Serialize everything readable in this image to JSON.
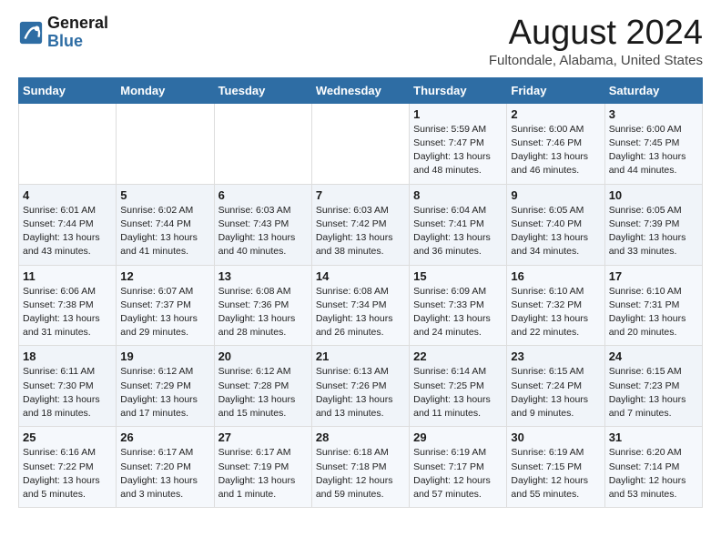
{
  "app": {
    "logo_line1": "General",
    "logo_line2": "Blue"
  },
  "header": {
    "title": "August 2024",
    "subtitle": "Fultondale, Alabama, United States"
  },
  "calendar": {
    "days_of_week": [
      "Sunday",
      "Monday",
      "Tuesday",
      "Wednesday",
      "Thursday",
      "Friday",
      "Saturday"
    ],
    "weeks": [
      [
        {
          "day": "",
          "info": ""
        },
        {
          "day": "",
          "info": ""
        },
        {
          "day": "",
          "info": ""
        },
        {
          "day": "",
          "info": ""
        },
        {
          "day": "1",
          "info": "Sunrise: 5:59 AM\nSunset: 7:47 PM\nDaylight: 13 hours\nand 48 minutes."
        },
        {
          "day": "2",
          "info": "Sunrise: 6:00 AM\nSunset: 7:46 PM\nDaylight: 13 hours\nand 46 minutes."
        },
        {
          "day": "3",
          "info": "Sunrise: 6:00 AM\nSunset: 7:45 PM\nDaylight: 13 hours\nand 44 minutes."
        }
      ],
      [
        {
          "day": "4",
          "info": "Sunrise: 6:01 AM\nSunset: 7:44 PM\nDaylight: 13 hours\nand 43 minutes."
        },
        {
          "day": "5",
          "info": "Sunrise: 6:02 AM\nSunset: 7:44 PM\nDaylight: 13 hours\nand 41 minutes."
        },
        {
          "day": "6",
          "info": "Sunrise: 6:03 AM\nSunset: 7:43 PM\nDaylight: 13 hours\nand 40 minutes."
        },
        {
          "day": "7",
          "info": "Sunrise: 6:03 AM\nSunset: 7:42 PM\nDaylight: 13 hours\nand 38 minutes."
        },
        {
          "day": "8",
          "info": "Sunrise: 6:04 AM\nSunset: 7:41 PM\nDaylight: 13 hours\nand 36 minutes."
        },
        {
          "day": "9",
          "info": "Sunrise: 6:05 AM\nSunset: 7:40 PM\nDaylight: 13 hours\nand 34 minutes."
        },
        {
          "day": "10",
          "info": "Sunrise: 6:05 AM\nSunset: 7:39 PM\nDaylight: 13 hours\nand 33 minutes."
        }
      ],
      [
        {
          "day": "11",
          "info": "Sunrise: 6:06 AM\nSunset: 7:38 PM\nDaylight: 13 hours\nand 31 minutes."
        },
        {
          "day": "12",
          "info": "Sunrise: 6:07 AM\nSunset: 7:37 PM\nDaylight: 13 hours\nand 29 minutes."
        },
        {
          "day": "13",
          "info": "Sunrise: 6:08 AM\nSunset: 7:36 PM\nDaylight: 13 hours\nand 28 minutes."
        },
        {
          "day": "14",
          "info": "Sunrise: 6:08 AM\nSunset: 7:34 PM\nDaylight: 13 hours\nand 26 minutes."
        },
        {
          "day": "15",
          "info": "Sunrise: 6:09 AM\nSunset: 7:33 PM\nDaylight: 13 hours\nand 24 minutes."
        },
        {
          "day": "16",
          "info": "Sunrise: 6:10 AM\nSunset: 7:32 PM\nDaylight: 13 hours\nand 22 minutes."
        },
        {
          "day": "17",
          "info": "Sunrise: 6:10 AM\nSunset: 7:31 PM\nDaylight: 13 hours\nand 20 minutes."
        }
      ],
      [
        {
          "day": "18",
          "info": "Sunrise: 6:11 AM\nSunset: 7:30 PM\nDaylight: 13 hours\nand 18 minutes."
        },
        {
          "day": "19",
          "info": "Sunrise: 6:12 AM\nSunset: 7:29 PM\nDaylight: 13 hours\nand 17 minutes."
        },
        {
          "day": "20",
          "info": "Sunrise: 6:12 AM\nSunset: 7:28 PM\nDaylight: 13 hours\nand 15 minutes."
        },
        {
          "day": "21",
          "info": "Sunrise: 6:13 AM\nSunset: 7:26 PM\nDaylight: 13 hours\nand 13 minutes."
        },
        {
          "day": "22",
          "info": "Sunrise: 6:14 AM\nSunset: 7:25 PM\nDaylight: 13 hours\nand 11 minutes."
        },
        {
          "day": "23",
          "info": "Sunrise: 6:15 AM\nSunset: 7:24 PM\nDaylight: 13 hours\nand 9 minutes."
        },
        {
          "day": "24",
          "info": "Sunrise: 6:15 AM\nSunset: 7:23 PM\nDaylight: 13 hours\nand 7 minutes."
        }
      ],
      [
        {
          "day": "25",
          "info": "Sunrise: 6:16 AM\nSunset: 7:22 PM\nDaylight: 13 hours\nand 5 minutes."
        },
        {
          "day": "26",
          "info": "Sunrise: 6:17 AM\nSunset: 7:20 PM\nDaylight: 13 hours\nand 3 minutes."
        },
        {
          "day": "27",
          "info": "Sunrise: 6:17 AM\nSunset: 7:19 PM\nDaylight: 13 hours\nand 1 minute."
        },
        {
          "day": "28",
          "info": "Sunrise: 6:18 AM\nSunset: 7:18 PM\nDaylight: 12 hours\nand 59 minutes."
        },
        {
          "day": "29",
          "info": "Sunrise: 6:19 AM\nSunset: 7:17 PM\nDaylight: 12 hours\nand 57 minutes."
        },
        {
          "day": "30",
          "info": "Sunrise: 6:19 AM\nSunset: 7:15 PM\nDaylight: 12 hours\nand 55 minutes."
        },
        {
          "day": "31",
          "info": "Sunrise: 6:20 AM\nSunset: 7:14 PM\nDaylight: 12 hours\nand 53 minutes."
        }
      ]
    ]
  }
}
